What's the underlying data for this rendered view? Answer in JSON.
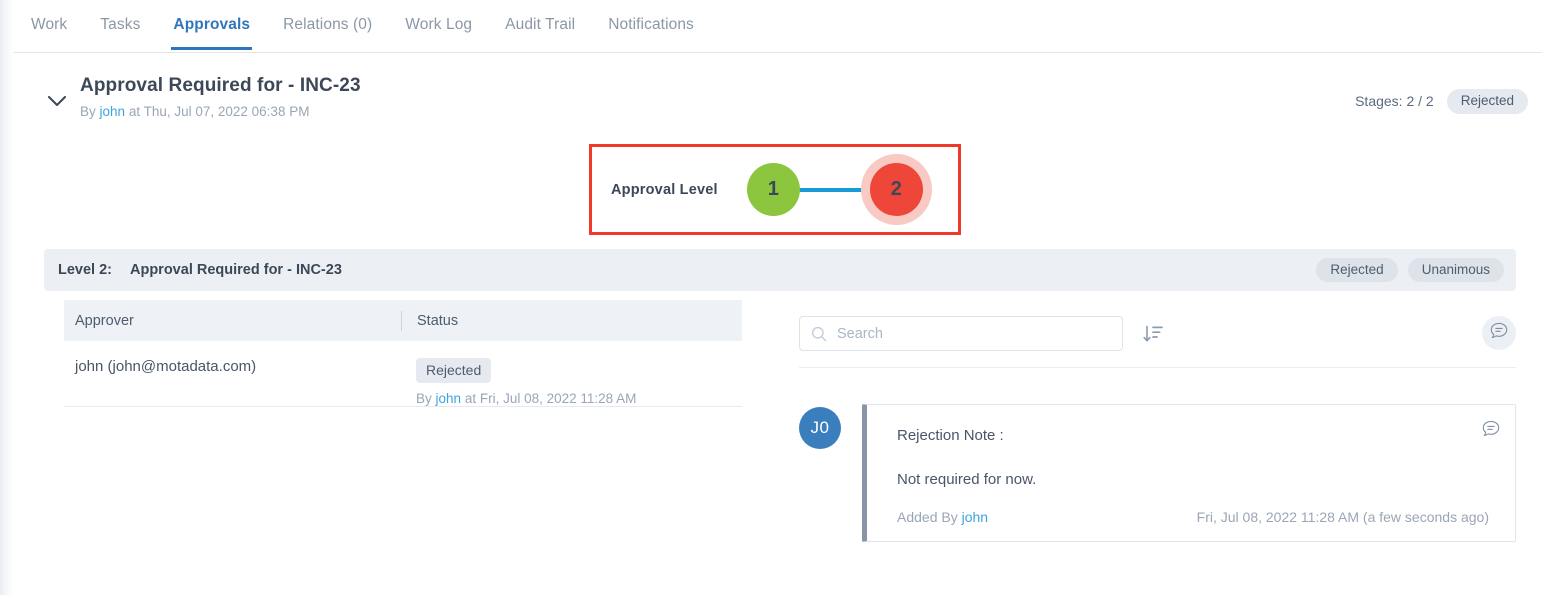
{
  "tabs": [
    {
      "label": "Work",
      "active": false
    },
    {
      "label": "Tasks",
      "active": false
    },
    {
      "label": "Approvals",
      "active": true
    },
    {
      "label": "Relations (0)",
      "active": false
    },
    {
      "label": "Work Log",
      "active": false
    },
    {
      "label": "Audit Trail",
      "active": false
    },
    {
      "label": "Notifications",
      "active": false
    }
  ],
  "approval_header": {
    "title": "Approval Required for - INC-23",
    "by_prefix": "By",
    "by_user": "john",
    "at_text": "at Thu, Jul 07, 2022 06:38 PM",
    "stages_label": "Stages: 2 / 2",
    "status": "Rejected",
    "chevron_icon": "chevron-down-icon"
  },
  "stepper": {
    "label": "Approval Level",
    "highlight_color": "#f0392b",
    "steps": [
      {
        "number": "1",
        "state": "approved",
        "color": "#8cc63e"
      },
      {
        "number": "2",
        "state": "rejected",
        "color": "#ee4638",
        "ring_color": "#f9c9c4"
      }
    ],
    "connector_color": "#1a9bd7"
  },
  "level_bar": {
    "level_label": "Level 2:",
    "title": "Approval Required for - INC-23",
    "badges": [
      "Rejected",
      "Unanimous"
    ]
  },
  "approver_table": {
    "columns": [
      "Approver",
      "Status"
    ],
    "rows": [
      {
        "approver": "john (john@motadata.com)",
        "status": "Rejected",
        "meta_prefix": "By",
        "meta_user": "john",
        "meta_suffix": "at Fri, Jul 08, 2022 11:28 AM"
      }
    ]
  },
  "right_panel": {
    "search": {
      "placeholder": "Search",
      "value": "",
      "icon": "search-icon"
    },
    "sort_icon": "sort-descending-icon",
    "note_toggle_icon": "comment-icon",
    "note": {
      "avatar_initials": "J0",
      "title": "Rejection Note :",
      "body": "Not required for now.",
      "added_by_prefix": "Added By",
      "added_by_user": "john",
      "timestamp": "Fri, Jul 08, 2022 11:28 AM (a few seconds ago)",
      "card_icon": "comment-icon"
    }
  }
}
